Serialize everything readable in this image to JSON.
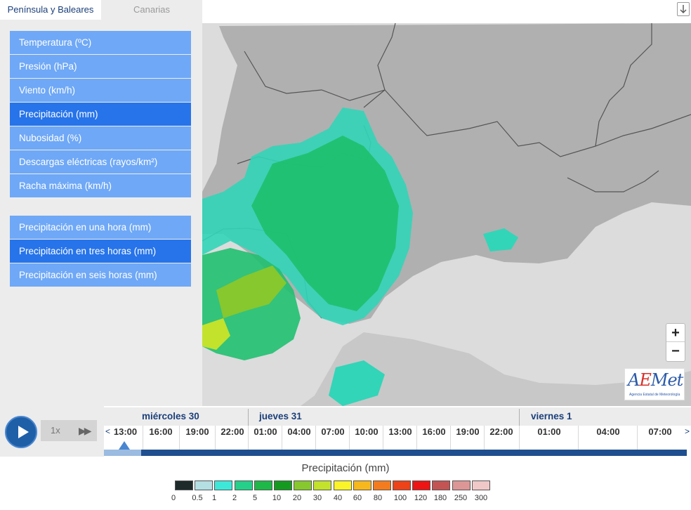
{
  "tabs": [
    {
      "label": "Península y Baleares",
      "active": true
    },
    {
      "label": "Canarias",
      "active": false
    }
  ],
  "variables": [
    {
      "label": "Temperatura (ºC)",
      "active": false
    },
    {
      "label": "Presión (hPa)",
      "active": false
    },
    {
      "label": "Viento (km/h)",
      "active": false
    },
    {
      "label": "Precipitación (mm)",
      "active": true
    },
    {
      "label": "Nubosidad (%)",
      "active": false
    },
    {
      "label": "Descargas eléctricas (rayos/km²)",
      "active": false
    },
    {
      "label": "Racha máxima (km/h)",
      "active": false
    }
  ],
  "sub_variables": [
    {
      "label": "Precipitación en una hora (mm)",
      "active": false
    },
    {
      "label": "Precipitación en tres horas (mm)",
      "active": true
    },
    {
      "label": "Precipitación en seis horas (mm)",
      "active": false
    }
  ],
  "map": {
    "zoom_in": "+",
    "zoom_out": "−",
    "download_icon": "download-icon",
    "logo": {
      "main": "AEMet",
      "subtitle": "Agencia Estatal de Meteorología"
    }
  },
  "player": {
    "speed": "1x",
    "play_icon": "play-icon",
    "fast_forward_icon": "fast-forward-icon",
    "prev_arrow": "<",
    "next_arrow": ">"
  },
  "timeline": {
    "days": [
      "miércoles 30",
      "jueves 31",
      "viernes 1"
    ],
    "hours": [
      "13:00",
      "16:00",
      "19:00",
      "22:00",
      "01:00",
      "04:00",
      "07:00",
      "10:00",
      "13:00",
      "16:00",
      "19:00",
      "22:00",
      "01:00",
      "04:00",
      "07:00"
    ],
    "selected_hour_index": 0,
    "progress_fraction": 0.064
  },
  "legend": {
    "title": "Precipitación (mm)",
    "labels": [
      "0",
      "0.5",
      "1",
      "2",
      "5",
      "10",
      "20",
      "30",
      "40",
      "60",
      "80",
      "100",
      "120",
      "180",
      "250",
      "300"
    ],
    "colors": [
      "#1e2a2a",
      "#b4dfe3",
      "#3ee8d8",
      "#24d08a",
      "#1eb848",
      "#159a20",
      "#86c82e",
      "#c2e22c",
      "#faf428",
      "#f7b81e",
      "#f47c1e",
      "#ee4218",
      "#ee1414",
      "#c45454",
      "#dc9696",
      "#f0c8c8"
    ]
  }
}
